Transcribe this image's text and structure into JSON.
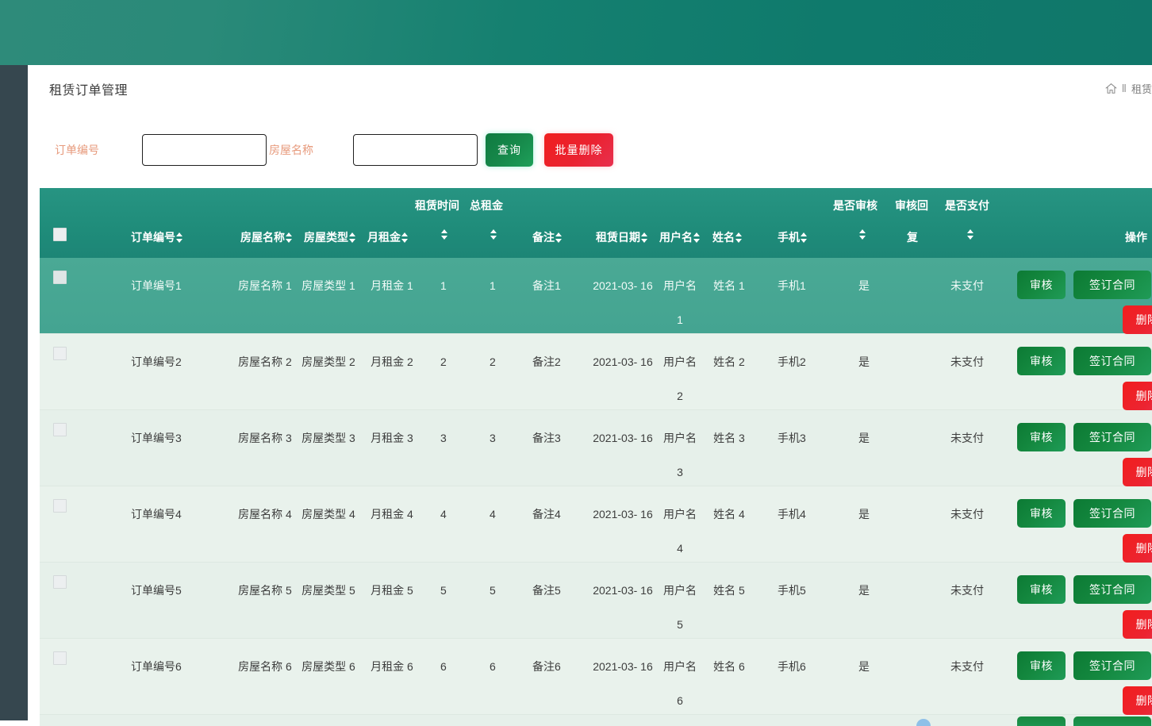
{
  "page": {
    "title": "租赁订单管理"
  },
  "breadcrumb": {
    "home_icon": "home-icon",
    "separator": "Ⅱ",
    "current": "租赁"
  },
  "filter": {
    "order_no_label": "订单编号",
    "order_no_value": "",
    "order_no_placeholder": "",
    "house_name_label": "房屋名称",
    "house_name_value": "",
    "house_name_placeholder": "",
    "query_button": "查询",
    "batch_delete_button": "批量删除"
  },
  "table": {
    "group_headers": [
      {
        "label": "租赁时间"
      },
      {
        "label": "总租金"
      },
      {
        "label": "是否审核"
      },
      {
        "label": "审核回"
      },
      {
        "label": "复"
      },
      {
        "label": "是否支付"
      }
    ],
    "columns": [
      {
        "label": "订单编号",
        "sortable": true
      },
      {
        "label": "房屋名称",
        "sortable": true
      },
      {
        "label": "房屋类型",
        "sortable": true
      },
      {
        "label": "月租金",
        "sortable": true
      },
      {
        "label": "",
        "sortable": true
      },
      {
        "label": "",
        "sortable": true
      },
      {
        "label": "备注",
        "sortable": true
      },
      {
        "label": "租赁日期",
        "sortable": true
      },
      {
        "label": "用户名",
        "sortable": true
      },
      {
        "label": "姓名",
        "sortable": true
      },
      {
        "label": "手机",
        "sortable": true
      },
      {
        "label": "",
        "sortable": true
      },
      {
        "label": "复",
        "sortable": false
      },
      {
        "label": "",
        "sortable": true
      },
      {
        "label": "操作",
        "sortable": false
      }
    ],
    "row_buttons": {
      "audit": "审核",
      "sign": "签订合同",
      "delete": "删除"
    },
    "rows": [
      {
        "order_no": "订单编号1",
        "house_name": "房屋名称 1",
        "house_type": "房屋类型 1",
        "monthly_rent": "月租金 1",
        "lease_time": "1",
        "total_rent": "1",
        "remark": "备注1",
        "lease_date": "2021-03- 16",
        "username": "用户名 1",
        "name": "姓名 1",
        "phone": "手机1",
        "is_audited": "是",
        "audit_reply": "",
        "is_paid": "未支付"
      },
      {
        "order_no": "订单编号2",
        "house_name": "房屋名称 2",
        "house_type": "房屋类型 2",
        "monthly_rent": "月租金 2",
        "lease_time": "2",
        "total_rent": "2",
        "remark": "备注2",
        "lease_date": "2021-03- 16",
        "username": "用户名 2",
        "name": "姓名 2",
        "phone": "手机2",
        "is_audited": "是",
        "audit_reply": "",
        "is_paid": "未支付"
      },
      {
        "order_no": "订单编号3",
        "house_name": "房屋名称 3",
        "house_type": "房屋类型 3",
        "monthly_rent": "月租金 3",
        "lease_time": "3",
        "total_rent": "3",
        "remark": "备注3",
        "lease_date": "2021-03- 16",
        "username": "用户名 3",
        "name": "姓名 3",
        "phone": "手机3",
        "is_audited": "是",
        "audit_reply": "",
        "is_paid": "未支付"
      },
      {
        "order_no": "订单编号4",
        "house_name": "房屋名称 4",
        "house_type": "房屋类型 4",
        "monthly_rent": "月租金 4",
        "lease_time": "4",
        "total_rent": "4",
        "remark": "备注4",
        "lease_date": "2021-03- 16",
        "username": "用户名 4",
        "name": "姓名 4",
        "phone": "手机4",
        "is_audited": "是",
        "audit_reply": "",
        "is_paid": "未支付"
      },
      {
        "order_no": "订单编号5",
        "house_name": "房屋名称 5",
        "house_type": "房屋类型 5",
        "monthly_rent": "月租金 5",
        "lease_time": "5",
        "total_rent": "5",
        "remark": "备注5",
        "lease_date": "2021-03- 16",
        "username": "用户名 5",
        "name": "姓名 5",
        "phone": "手机5",
        "is_audited": "是",
        "audit_reply": "",
        "is_paid": "未支付"
      },
      {
        "order_no": "订单编号6",
        "house_name": "房屋名称 6",
        "house_type": "房屋类型 6",
        "monthly_rent": "月租金 6",
        "lease_time": "6",
        "total_rent": "6",
        "remark": "备注6",
        "lease_date": "2021-03- 16",
        "username": "用户名 6",
        "name": "姓名 6",
        "phone": "手机6",
        "is_audited": "是",
        "audit_reply": "",
        "is_paid": "未支付"
      }
    ]
  },
  "colors": {
    "topbar_teal": "#158070",
    "sidebar_dark": "#36474f",
    "table_header": "#1f8c7a",
    "hover_row": "#4aa995",
    "row_light": "#e9f2ec",
    "label_coral": "#e79a7c",
    "btn_green": "#14883f",
    "btn_red": "#ec2431"
  }
}
